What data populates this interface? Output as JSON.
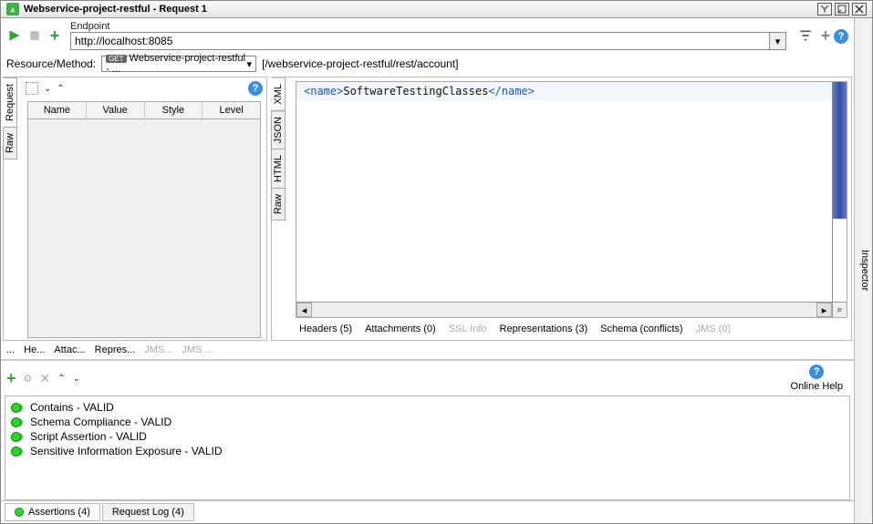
{
  "window": {
    "title": "Webservice-project-restful - Request 1"
  },
  "toolbar": {
    "endpoint_label": "Endpoint",
    "endpoint_value": "http://localhost:8085"
  },
  "resource_row": {
    "label": "Resource/Method:",
    "combo": "Webservice-project-restful - ...",
    "path": "[/webservice-project-restful/rest/account]"
  },
  "request": {
    "sidetabs": {
      "request": "Request",
      "raw": "Raw"
    },
    "columns": {
      "name": "Name",
      "value": "Value",
      "style": "Style",
      "level": "Level"
    },
    "bottom": {
      "more": "...",
      "headers": "He...",
      "attachments": "Attac...",
      "representations": "Repres...",
      "jms1": "JMS...",
      "jms2": "JMS ..."
    }
  },
  "response": {
    "sidetabs": {
      "xml": "XML",
      "json": "JSON",
      "html": "HTML",
      "raw": "Raw"
    },
    "xml_open": "<name>",
    "xml_text": "SoftwareTestingClasses",
    "xml_close": "</name>",
    "bottom": {
      "headers": "Headers (5)",
      "attachments": "Attachments (0)",
      "ssl": "SSL Info",
      "representations": "Representations (3)",
      "schema": "Schema (conflicts)",
      "jms": "JMS (0)"
    }
  },
  "assertions": {
    "online_help": "Online Help",
    "items": {
      "0": "Contains - VALID",
      "1": "Schema Compliance - VALID",
      "2": "Script Assertion - VALID",
      "3": "Sensitive Information Exposure - VALID"
    }
  },
  "footer": {
    "assertions_tab": "Assertions (4)",
    "requestlog_tab": "Request Log (4)"
  },
  "inspector_label": "Inspector"
}
